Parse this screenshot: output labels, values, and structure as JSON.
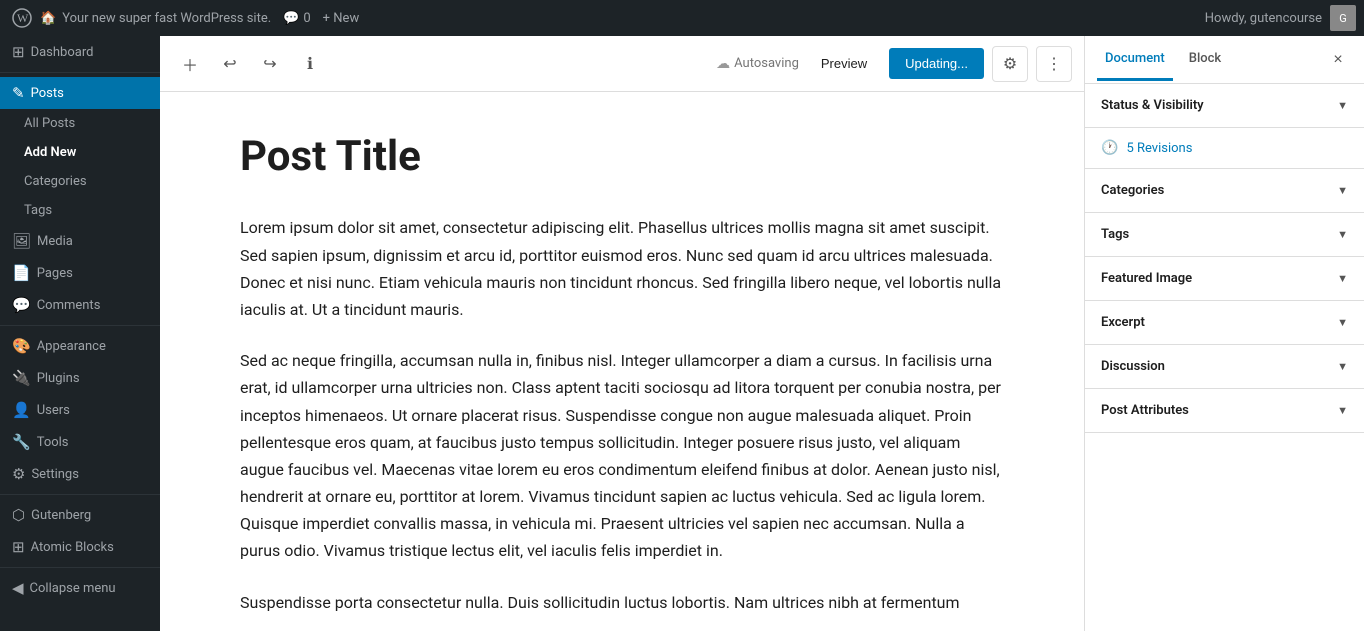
{
  "adminbar": {
    "wp_logo": "W",
    "site_name": "Your new super fast WordPress site.",
    "comments_label": "0",
    "new_label": "+ New",
    "howdy": "Howdy, gutencourse"
  },
  "sidebar": {
    "dashboard_label": "Dashboard",
    "nav_items": [
      {
        "id": "posts",
        "icon": "✎",
        "label": "Posts",
        "active": true
      },
      {
        "id": "all-posts",
        "icon": "",
        "label": "All Posts",
        "sub": true
      },
      {
        "id": "add-new",
        "icon": "",
        "label": "Add New",
        "sub": true,
        "highlight": true
      },
      {
        "id": "categories",
        "icon": "",
        "label": "Categories",
        "sub": true
      },
      {
        "id": "tags",
        "icon": "",
        "label": "Tags",
        "sub": true
      },
      {
        "id": "media",
        "icon": "🖼",
        "label": "Media"
      },
      {
        "id": "pages",
        "icon": "📄",
        "label": "Pages"
      },
      {
        "id": "comments",
        "icon": "💬",
        "label": "Comments"
      },
      {
        "id": "appearance",
        "icon": "🎨",
        "label": "Appearance"
      },
      {
        "id": "plugins",
        "icon": "🔌",
        "label": "Plugins"
      },
      {
        "id": "users",
        "icon": "👤",
        "label": "Users"
      },
      {
        "id": "tools",
        "icon": "🔧",
        "label": "Tools"
      },
      {
        "id": "settings",
        "icon": "⚙",
        "label": "Settings"
      }
    ],
    "gutenberg_label": "Gutenberg",
    "atomic_blocks_label": "Atomic Blocks",
    "collapse_label": "Collapse menu"
  },
  "toolbar": {
    "add_icon": "+",
    "undo_icon": "↩",
    "redo_icon": "↪",
    "info_icon": "ℹ",
    "autosaving_label": "Autosaving",
    "preview_label": "Preview",
    "update_label": "Updating...",
    "settings_icon": "⚙",
    "more_icon": "⋮"
  },
  "editor": {
    "post_title": "Post Title",
    "paragraphs": [
      "Lorem ipsum dolor sit amet, consectetur adipiscing elit. Phasellus ultrices mollis magna sit amet suscipit. Sed sapien ipsum, dignissim et arcu id, porttitor euismod eros. Nunc sed quam id arcu ultrices malesuada. Donec et nisi nunc. Etiam vehicula mauris non tincidunt rhoncus. Sed fringilla libero neque, vel lobortis nulla iaculis at. Ut a tincidunt mauris.",
      "Sed ac neque fringilla, accumsan nulla in, finibus nisl. Integer ullamcorper a diam a cursus. In facilisis urna erat, id ullamcorper urna ultricies non. Class aptent taciti sociosqu ad litora torquent per conubia nostra, per inceptos himenaeos. Ut ornare placerat risus. Suspendisse congue non augue malesuada aliquet. Proin pellentesque eros quam, at faucibus justo tempus sollicitudin. Integer posuere risus justo, vel aliquam augue faucibus vel. Maecenas vitae lorem eu eros condimentum eleifend finibus at dolor. Aenean justo nisl, hendrerit at ornare eu, porttitor at lorem. Vivamus tincidunt sapien ac luctus vehicula. Sed ac ligula lorem. Quisque imperdiet convallis massa, in vehicula mi. Praesent ultricies vel sapien nec accumsan. Nulla a purus odio. Vivamus tristique lectus elit, vel iaculis felis imperdiet in.",
      "Suspendisse porta consectetur nulla. Duis sollicitudin luctus lobortis. Nam ultrices nibh at fermentum"
    ]
  },
  "right_panel": {
    "tab_document": "Document",
    "tab_block": "Block",
    "close_label": "×",
    "sections": [
      {
        "id": "status-visibility",
        "label": "Status & Visibility",
        "expanded": false
      },
      {
        "id": "revisions",
        "label": "5 Revisions",
        "type": "revisions"
      },
      {
        "id": "categories",
        "label": "Categories",
        "expanded": false
      },
      {
        "id": "tags",
        "label": "Tags",
        "expanded": false
      },
      {
        "id": "featured-image",
        "label": "Featured Image",
        "expanded": false
      },
      {
        "id": "excerpt",
        "label": "Excerpt",
        "expanded": false
      },
      {
        "id": "discussion",
        "label": "Discussion",
        "expanded": false
      },
      {
        "id": "post-attributes",
        "label": "Post Attributes",
        "expanded": false
      }
    ]
  }
}
